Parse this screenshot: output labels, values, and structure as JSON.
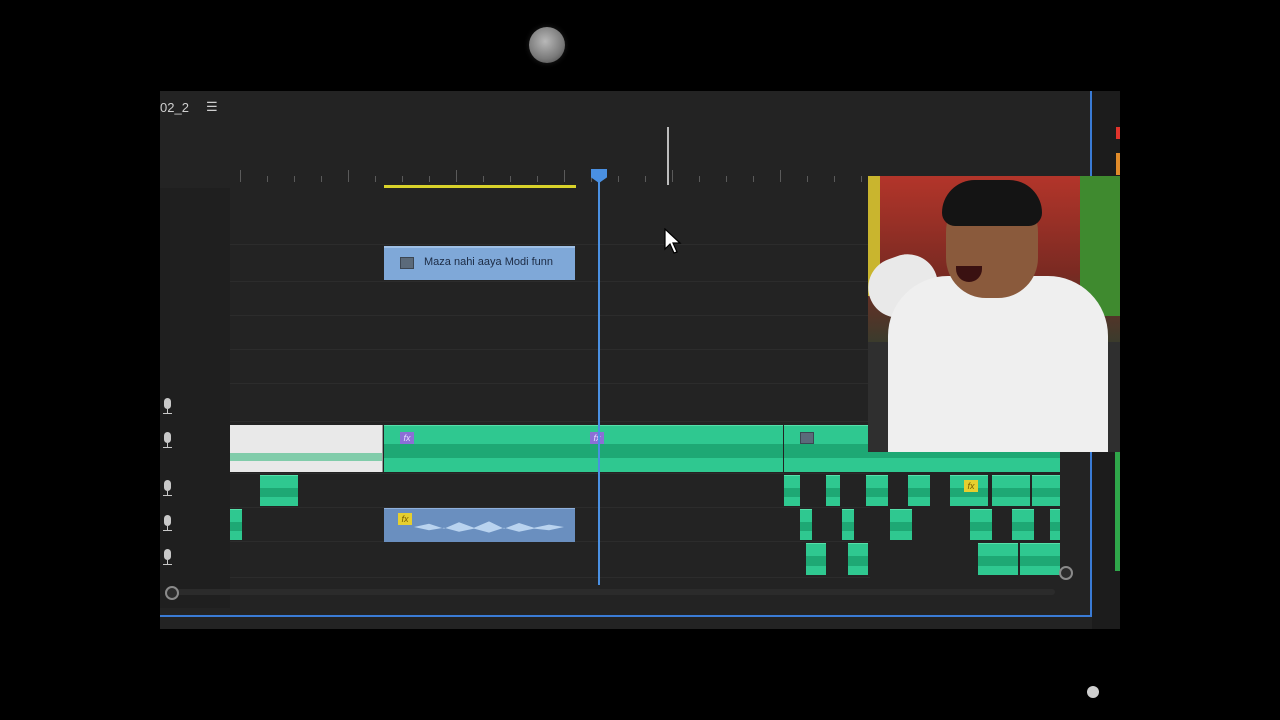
{
  "sequence": {
    "name": "02_2",
    "menu_icon": "hamburger-icon"
  },
  "title_clip": {
    "label": "Maza nahi aaya Modi funn",
    "icon": "clip-icon"
  },
  "fx_badge_label": "fx",
  "icons": {
    "record": "record-dot-icon",
    "mic": "microphone-icon",
    "cursor": "mouse-pointer-icon",
    "scroll_handle": "scroll-handle-icon"
  },
  "colors": {
    "panel": "#232323",
    "playhead": "#4a90e2",
    "work_area": "#d8d22a",
    "audio_clip": "#2fc890",
    "title_clip": "#7fa8d8",
    "fx_purple": "#8b6fd6",
    "fx_yellow": "#e6cf2e"
  }
}
